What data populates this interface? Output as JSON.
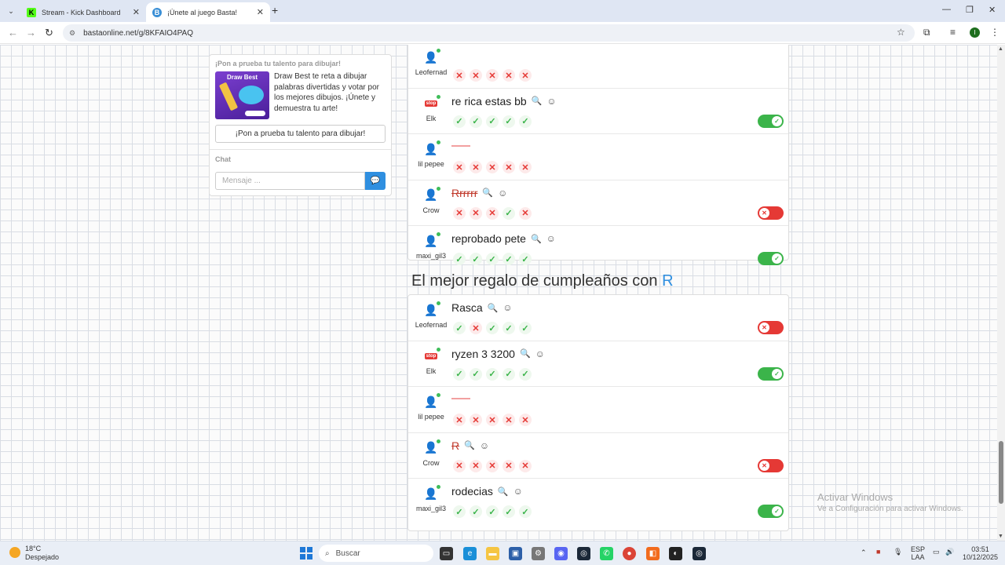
{
  "browser": {
    "tabs": [
      {
        "title": "Stream - Kick Dashboard",
        "favicon": "K",
        "favicon_color": "#53fc18"
      },
      {
        "title": "¡Únete al juego Basta!",
        "favicon": "B",
        "favicon_color": "#3a8fd6"
      }
    ],
    "url": "bastaonline.net/g/8KFAIO4PAQ",
    "profile_initial": "I"
  },
  "sidebar": {
    "promo_heading": "¡Pon a prueba tu talento para dibujar!",
    "promo_image_label": "Draw Best",
    "promo_text": "Draw Best te reta a dibujar palabras divertidas y votar por los mejores dibujos. ¡Únete y demuestra tu arte!",
    "promo_button": "¡Pon a prueba tu talento para dibujar!",
    "chat_heading": "Chat",
    "chat_placeholder": "Mensaje ..."
  },
  "panel1": {
    "rows": [
      {
        "player": "Leofernad",
        "avatar": "person",
        "answer": "",
        "show_answer": false,
        "votes": [
          "no",
          "no",
          "no",
          "no",
          "no"
        ],
        "toggle": null
      },
      {
        "player": "Elk",
        "avatar": "stop",
        "answer": "re rica estas bb",
        "show_answer": true,
        "votes": [
          "ok",
          "ok",
          "ok",
          "ok",
          "ok"
        ],
        "toggle": "on"
      },
      {
        "player": "lil pepee",
        "avatar": "person",
        "answer": "",
        "blank": true,
        "votes": [
          "no",
          "no",
          "no",
          "no",
          "no"
        ],
        "toggle": null
      },
      {
        "player": "Crow",
        "avatar": "person",
        "answer": "Rrrrrr",
        "show_answer": true,
        "strike": true,
        "votes": [
          "no",
          "no",
          "no",
          "ok",
          "no"
        ],
        "toggle": "off"
      },
      {
        "player": "maxi_gil3",
        "avatar": "person",
        "answer": "reprobado pete",
        "show_answer": true,
        "votes": [
          "ok",
          "ok",
          "ok",
          "ok",
          "ok"
        ],
        "toggle": "on"
      }
    ]
  },
  "section2": {
    "title": "El mejor regalo de cumpleaños con",
    "letter": "R"
  },
  "panel2": {
    "rows": [
      {
        "player": "Leofernad",
        "avatar": "person",
        "answer": "Rasca",
        "show_answer": true,
        "votes": [
          "ok",
          "no",
          "ok",
          "ok",
          "ok"
        ],
        "toggle": "off"
      },
      {
        "player": "Elk",
        "avatar": "stop",
        "answer": "ryzen 3 3200",
        "show_answer": true,
        "votes": [
          "ok",
          "ok",
          "ok",
          "ok",
          "ok"
        ],
        "toggle": "on"
      },
      {
        "player": "lil pepee",
        "avatar": "person",
        "answer": "",
        "blank": true,
        "votes": [
          "no",
          "no",
          "no",
          "no",
          "no"
        ],
        "toggle": null
      },
      {
        "player": "Crow",
        "avatar": "person",
        "answer": "R",
        "show_answer": true,
        "strike": true,
        "votes": [
          "no",
          "no",
          "no",
          "no",
          "no"
        ],
        "toggle": "off"
      },
      {
        "player": "maxi_gil3",
        "avatar": "person",
        "answer": "rodecias",
        "show_answer": true,
        "votes": [
          "ok",
          "ok",
          "ok",
          "ok",
          "ok"
        ],
        "toggle": "on"
      }
    ]
  },
  "watermark": {
    "line1": "Activar Windows",
    "line2": "Ve a Configuración para activar Windows."
  },
  "taskbar": {
    "temp": "18°C",
    "weather": "Despejado",
    "search_placeholder": "Buscar",
    "lang": "ESP",
    "lang_sub": "LAA",
    "time": "03:51",
    "date": "10/12/2025"
  }
}
